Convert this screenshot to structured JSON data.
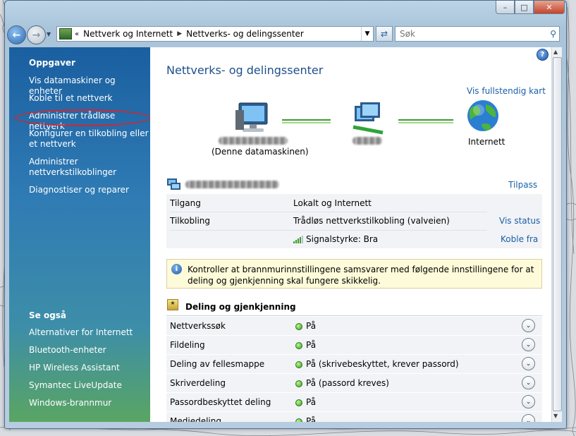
{
  "nav": {
    "breadcrumb": [
      "Nettverk og Internett",
      "Nettverks- og delingssenter"
    ],
    "search_placeholder": "Søk"
  },
  "sidebar": {
    "tasks_heading": "Oppgaver",
    "tasks": [
      "Vis datamaskiner og enheter",
      "Koble til et nettverk",
      "Administrer trådløse nettverk",
      "Konfigurer en tilkobling eller et nettverk",
      "Administrer nettverkstilkoblinger",
      "Diagnostiser og reparer"
    ],
    "see_also_heading": "Se også",
    "see_also": [
      "Alternativer for Internett",
      "Bluetooth-enheter",
      "HP Wireless Assistant",
      "Symantec LiveUpdate",
      "Windows-brannmur"
    ]
  },
  "main": {
    "title": "Nettverks- og delingssenter",
    "full_map_link": "Vis fullstendig kart",
    "map": {
      "computer_label": "(Denne datamaskinen)",
      "internet_label": "Internett"
    },
    "network": {
      "customize_link": "Tilpass",
      "rows": [
        {
          "label": "Tilgang",
          "value": "Lokalt og Internett",
          "link": ""
        },
        {
          "label": "Tilkobling",
          "value": "Trådløs nettverkstilkobling (valveien)",
          "link": "Vis status"
        },
        {
          "label": "",
          "value": "Signalstyrke: Bra",
          "link": "Koble fra"
        }
      ]
    },
    "info_text": "Kontroller at brannmurinnstillingene samsvarer med følgende innstillingene for at deling og gjenkjenning skal fungere skikkelig.",
    "sharing": {
      "heading": "Deling og gjenkjenning",
      "rows": [
        {
          "label": "Nettverkssøk",
          "status": "På"
        },
        {
          "label": "Fildeling",
          "status": "På"
        },
        {
          "label": "Deling av fellesmappe",
          "status": "På (skrivebeskyttet, krever passord)"
        },
        {
          "label": "Skriverdeling",
          "status": "På (passord kreves)"
        },
        {
          "label": "Passordbeskyttet deling",
          "status": "På"
        },
        {
          "label": "Mediedeling",
          "status": "På"
        }
      ]
    }
  },
  "colors": {
    "sidebar_top": "#1a5fa0",
    "sidebar_bottom": "#5aa562",
    "link": "#1a5fa8",
    "title": "#1e4f8c",
    "highlight_ellipse": "#d8242e",
    "info_bg": "#fdfbd9"
  }
}
